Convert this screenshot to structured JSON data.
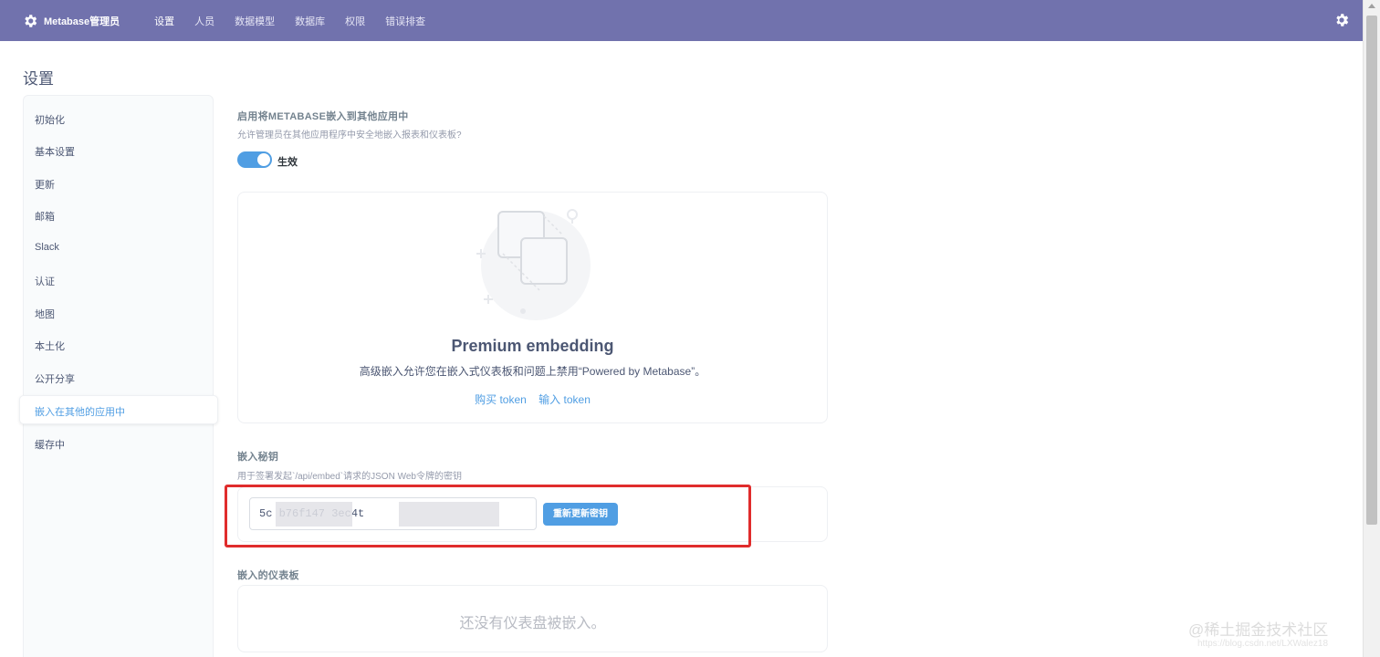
{
  "header": {
    "brand": "Metabase管理员",
    "nav": [
      "设置",
      "人员",
      "数据模型",
      "数据库",
      "权限",
      "错误排查"
    ],
    "active_nav": "设置"
  },
  "page_title": "设置",
  "sidebar": {
    "items": [
      "初始化",
      "基本设置",
      "更新",
      "邮箱",
      "Slack",
      "认证",
      "地图",
      "本土化",
      "公开分享",
      "嵌入在其他的应用中",
      "缓存中"
    ],
    "active": "嵌入在其他的应用中"
  },
  "embedding": {
    "title": "启用将METABASE嵌入到其他应用中",
    "description": "允许管理员在其他应用程序中安全地嵌入报表和仪表板?",
    "toggle_label": "生效",
    "toggle_on": true
  },
  "premium": {
    "title": "Premium embedding",
    "description": "高级嵌入允许您在嵌入式仪表板和问题上禁用“Powered by Metabase”。",
    "buy_token": "购买 token",
    "enter_token": "输入 token"
  },
  "secret_key": {
    "title": "嵌入秘钥",
    "description": "用于签署发起`/api/embed`请求的JSON Web令牌的密钥",
    "value": "5c            b76f147          3ec4t",
    "regenerate_label": "重新更新密钥"
  },
  "embedded_dashboards": {
    "title": "嵌入的仪表板",
    "empty_text": "还没有仪表盘被嵌入。"
  },
  "watermark": {
    "text": "@稀土掘金技术社区",
    "url": "https://blog.csdn.net/LXWalez18"
  },
  "colors": {
    "nav_bg": "#7172ad",
    "accent": "#509ee3",
    "highlight": "#e02c2c"
  }
}
